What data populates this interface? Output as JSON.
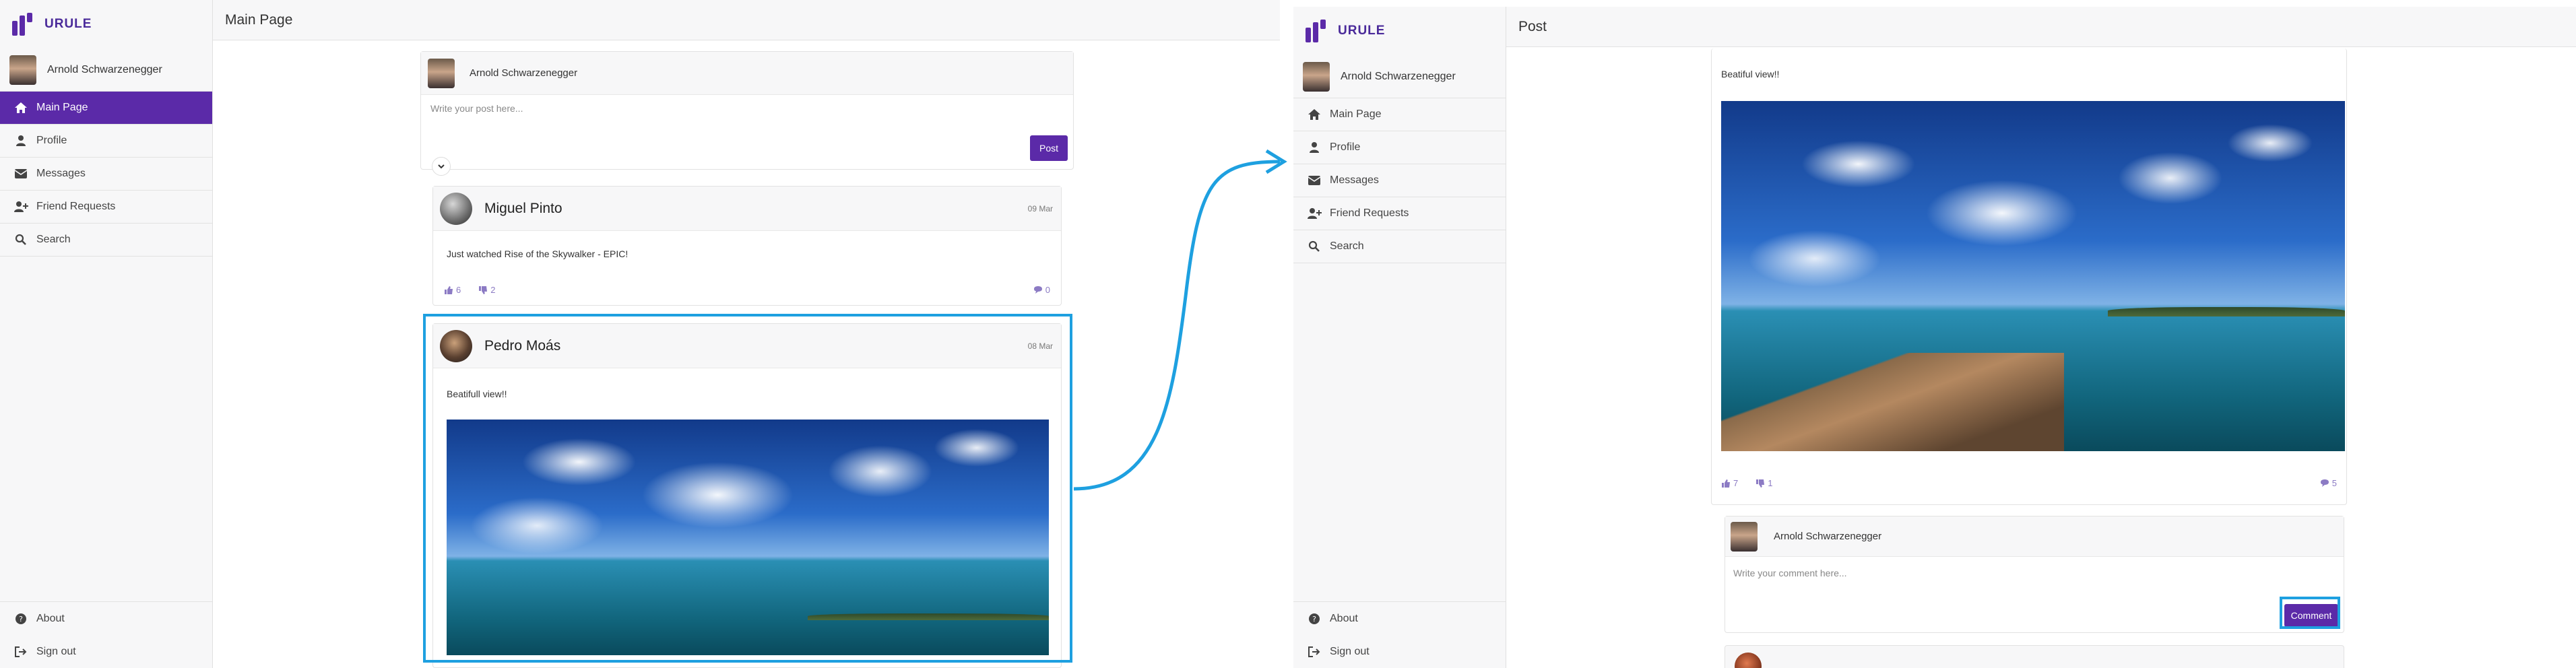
{
  "app": {
    "brand": "URULE",
    "user_name": "Arnold Schwarzenegger"
  },
  "nav": {
    "items": [
      {
        "label": "Main Page",
        "icon": "home-icon"
      },
      {
        "label": "Profile",
        "icon": "user-icon"
      },
      {
        "label": "Messages",
        "icon": "envelope-icon"
      },
      {
        "label": "Friend Requests",
        "icon": "user-plus-icon"
      },
      {
        "label": "Search",
        "icon": "search-icon"
      }
    ],
    "bottom": [
      {
        "label": "About",
        "icon": "question-circle-icon"
      },
      {
        "label": "Sign out",
        "icon": "sign-out-icon"
      }
    ]
  },
  "left": {
    "page_title": "Main Page",
    "composer": {
      "user": "Arnold Schwarzenegger",
      "placeholder": "Write your post here...",
      "post_label": "Post"
    },
    "posts": [
      {
        "author": "Miguel Pinto",
        "date": "09 Mar",
        "text": "Just watched Rise of the Skywalker - EPIC!",
        "likes": "6",
        "dislikes": "2",
        "comments": "0"
      },
      {
        "author": "Pedro Moás",
        "date": "08 Mar",
        "text": "Beatifull view!!"
      }
    ]
  },
  "right": {
    "page_title": "Post",
    "post": {
      "text": "Beatiful view!!",
      "likes": "7",
      "dislikes": "1",
      "comments": "5"
    },
    "comment_box": {
      "user": "Arnold Schwarzenegger",
      "placeholder": "Write your comment here...",
      "button_label": "Comment"
    }
  },
  "colors": {
    "accent": "#5b2aa8",
    "highlight": "#1ea0e0",
    "sidebar_bg": "#f7f7f8"
  }
}
